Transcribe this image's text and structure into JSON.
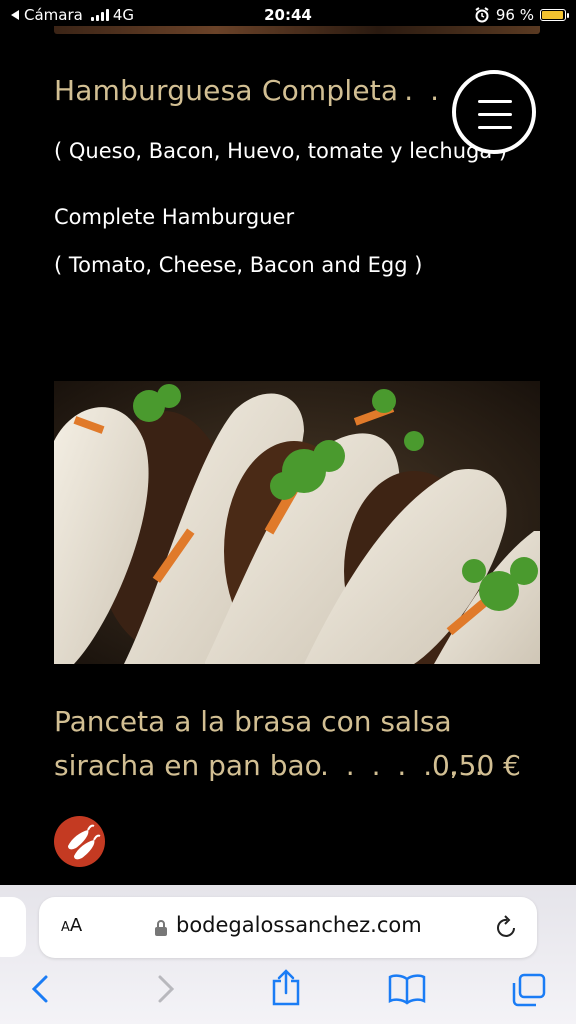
{
  "status": {
    "back_app": "Cámara",
    "network": "4G",
    "time": "20:44",
    "battery": "96 %",
    "battery_level": 0.96
  },
  "item1": {
    "title": "Hamburguesa Completa",
    "dots": ". . .",
    "price_partial": "1",
    "desc_es": "( Queso, Bacon, Huevo, tomate y lechuga )",
    "name_en": "Complete Hamburguer",
    "desc_en": "( Tomato, Cheese, Bacon and Egg )"
  },
  "item2": {
    "title_line1": "Panceta a la brasa con salsa",
    "title_line2": "siracha en pan bao",
    "dots": ". . . . . . .",
    "price": "0,50 €"
  },
  "browser": {
    "text_size": "AA",
    "url": "bodegalossanchez.com"
  },
  "icons": [
    "menu-icon",
    "chili-icon",
    "lock-icon",
    "reload-icon",
    "back-icon",
    "forward-icon",
    "share-icon",
    "bookmarks-icon",
    "tabs-icon"
  ],
  "colors": {
    "gold": "#d2bf93",
    "accent_blue": "#1a7cf5",
    "chili_red": "#c43a22"
  }
}
